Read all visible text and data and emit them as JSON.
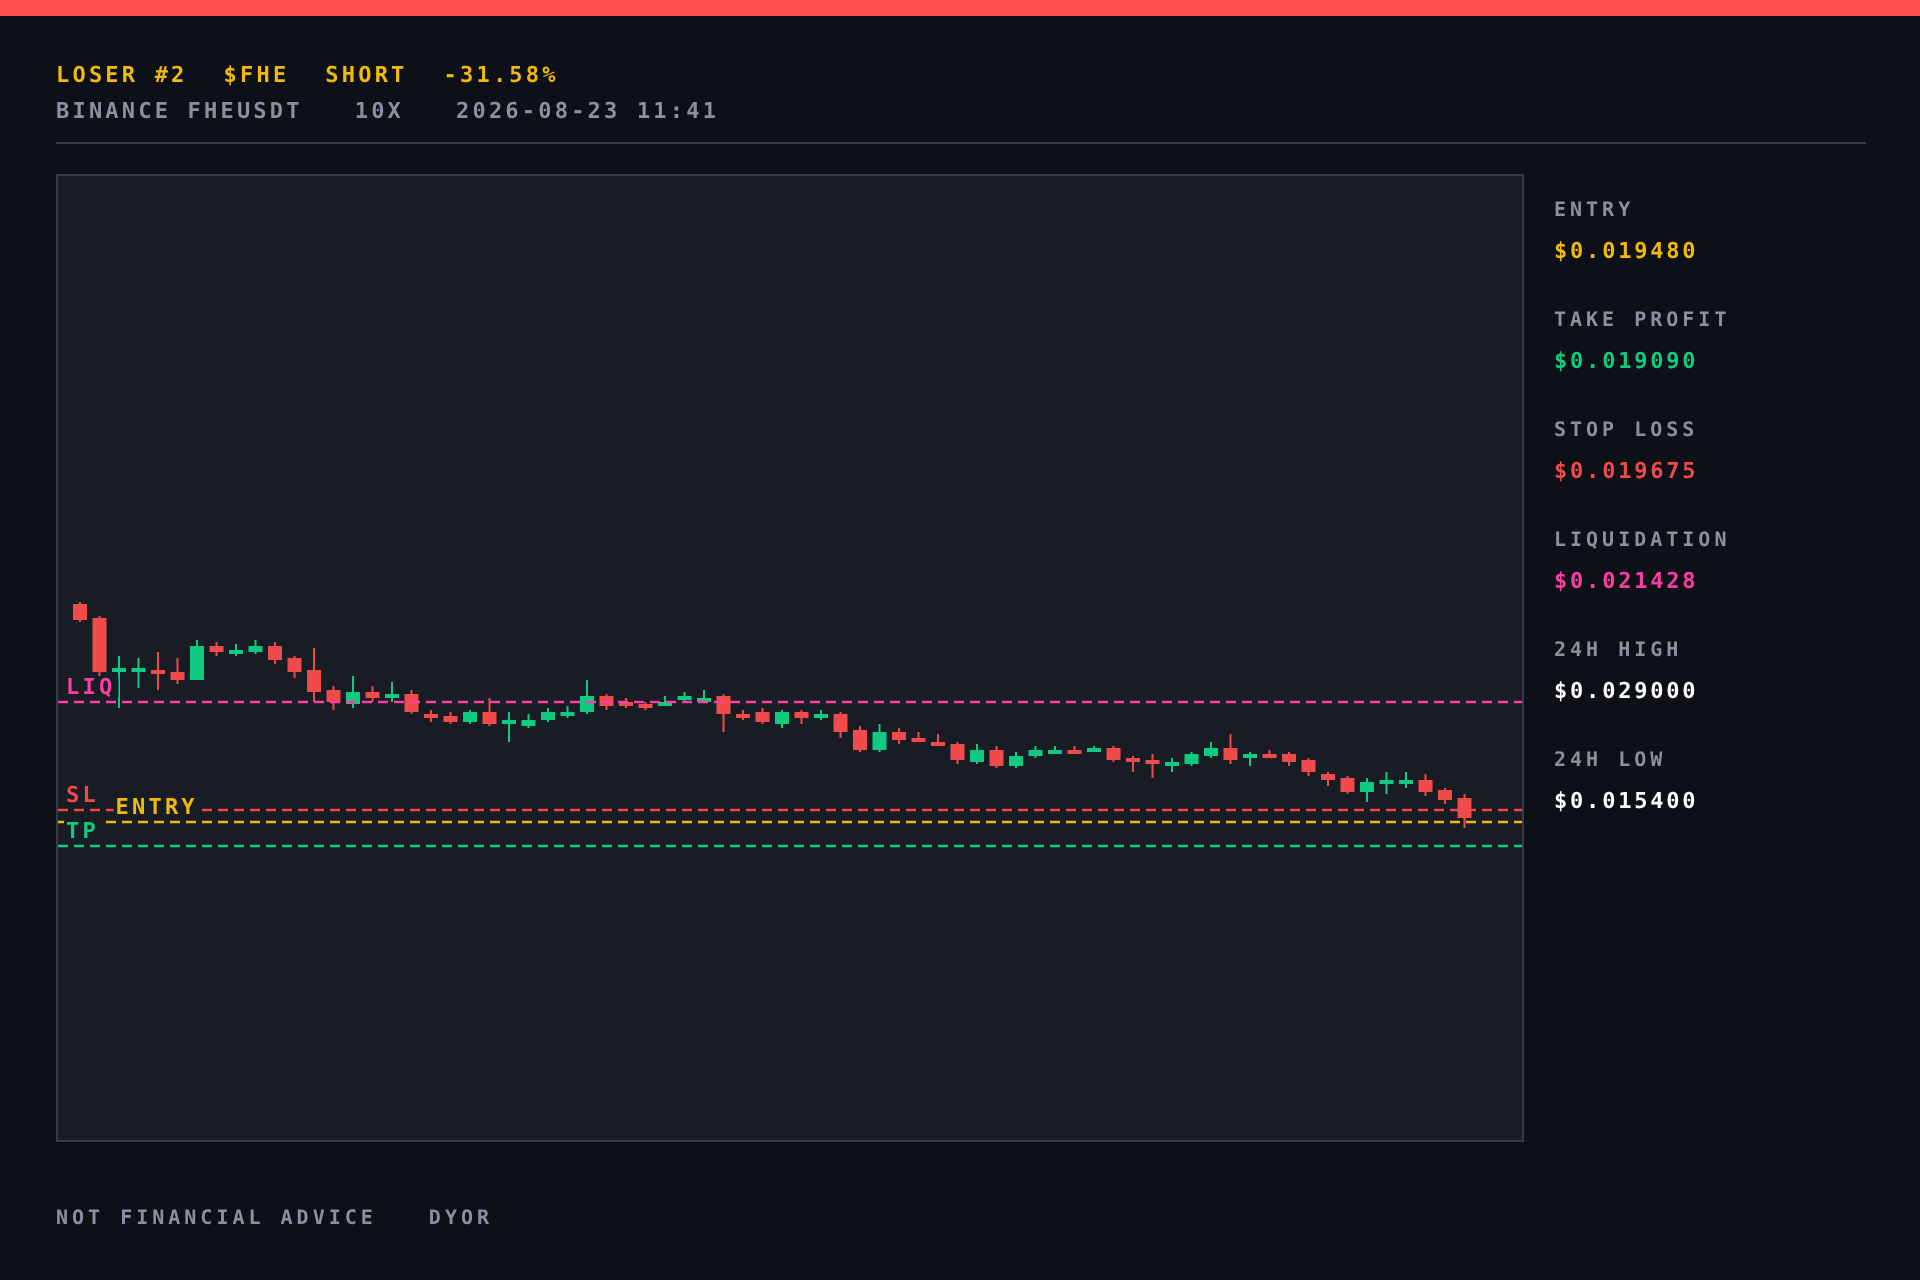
{
  "header": {
    "title_parts": [
      "LOSER #2",
      "$FHE",
      "SHORT",
      "-31.58%"
    ],
    "subtitle_parts": [
      "BINANCE FHEUSDT",
      "10X",
      "2026-08-23 11:41"
    ]
  },
  "chart": {
    "levels": [
      {
        "label": "LIQ",
        "color": "#ff3ea5"
      },
      {
        "label": "SL",
        "color": "#f04a4a"
      },
      {
        "label": "ENTRY",
        "color": "#f0b90b"
      },
      {
        "label": "TP",
        "color": "#0ecb81"
      }
    ]
  },
  "stats": [
    {
      "label": "ENTRY",
      "value": "$0.019480",
      "color": "#f0b90b"
    },
    {
      "label": "TAKE PROFIT",
      "value": "$0.019090",
      "color": "#0ecb81"
    },
    {
      "label": "STOP LOSS",
      "value": "$0.019675",
      "color": "#f04a4a"
    },
    {
      "label": "LIQUIDATION",
      "value": "$0.021428",
      "color": "#ff3ea5"
    },
    {
      "label": "24H HIGH",
      "value": "$0.029000",
      "color": "#ffffff"
    },
    {
      "label": "24H LOW",
      "value": "$0.015400",
      "color": "#ffffff"
    }
  ],
  "footer": {
    "parts": [
      "NOT FINANCIAL ADVICE",
      "DYOR"
    ]
  }
}
